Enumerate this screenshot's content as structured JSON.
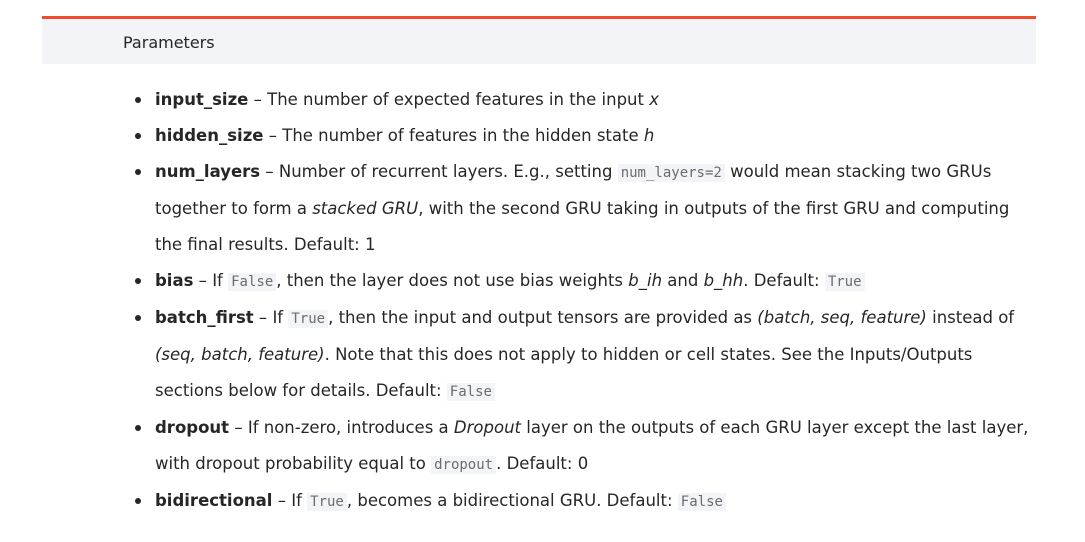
{
  "header": {
    "title": "Parameters"
  },
  "params": [
    {
      "name": "input_size",
      "dash": " – ",
      "t1": "The number of expected features in the input ",
      "e1": "x"
    },
    {
      "name": "hidden_size",
      "dash": " – ",
      "t1": "The number of features in the hidden state ",
      "e1": "h"
    },
    {
      "name": "num_layers",
      "dash": " – ",
      "t1": "Number of recurrent layers. E.g., setting ",
      "c1": "num_layers=2",
      "t2": " would mean stacking two GRUs together to form a ",
      "e1": "stacked GRU",
      "t3": ", with the second GRU taking in outputs of the first GRU and computing the final results. Default: 1"
    },
    {
      "name": "bias",
      "dash": " – ",
      "t1": "If ",
      "c1": "False",
      "t2": ", then the layer does not use bias weights ",
      "e1": "b_ih",
      "t3": " and ",
      "e2": "b_hh",
      "t4": ". Default: ",
      "c2": "True"
    },
    {
      "name": "batch_first",
      "dash": " – ",
      "t1": "If ",
      "c1": "True",
      "t2": ", then the input and output tensors are provided as ",
      "e1": "(batch, seq, feature)",
      "t3": " instead of ",
      "e2": "(seq, batch, feature)",
      "t4": ". Note that this does not apply to hidden or cell states. See the Inputs/Outputs sections below for details. Default: ",
      "c2": "False"
    },
    {
      "name": "dropout",
      "dash": " – ",
      "t1": "If non-zero, introduces a ",
      "e1": "Dropout",
      "t2": " layer on the outputs of each GRU layer except the last layer, with dropout probability equal to ",
      "c1": "dropout",
      "t3": ". Default: 0"
    },
    {
      "name": "bidirectional",
      "dash": " – ",
      "t1": "If ",
      "c1": "True",
      "t2": ", becomes a bidirectional GRU. Default: ",
      "c2": "False"
    }
  ]
}
